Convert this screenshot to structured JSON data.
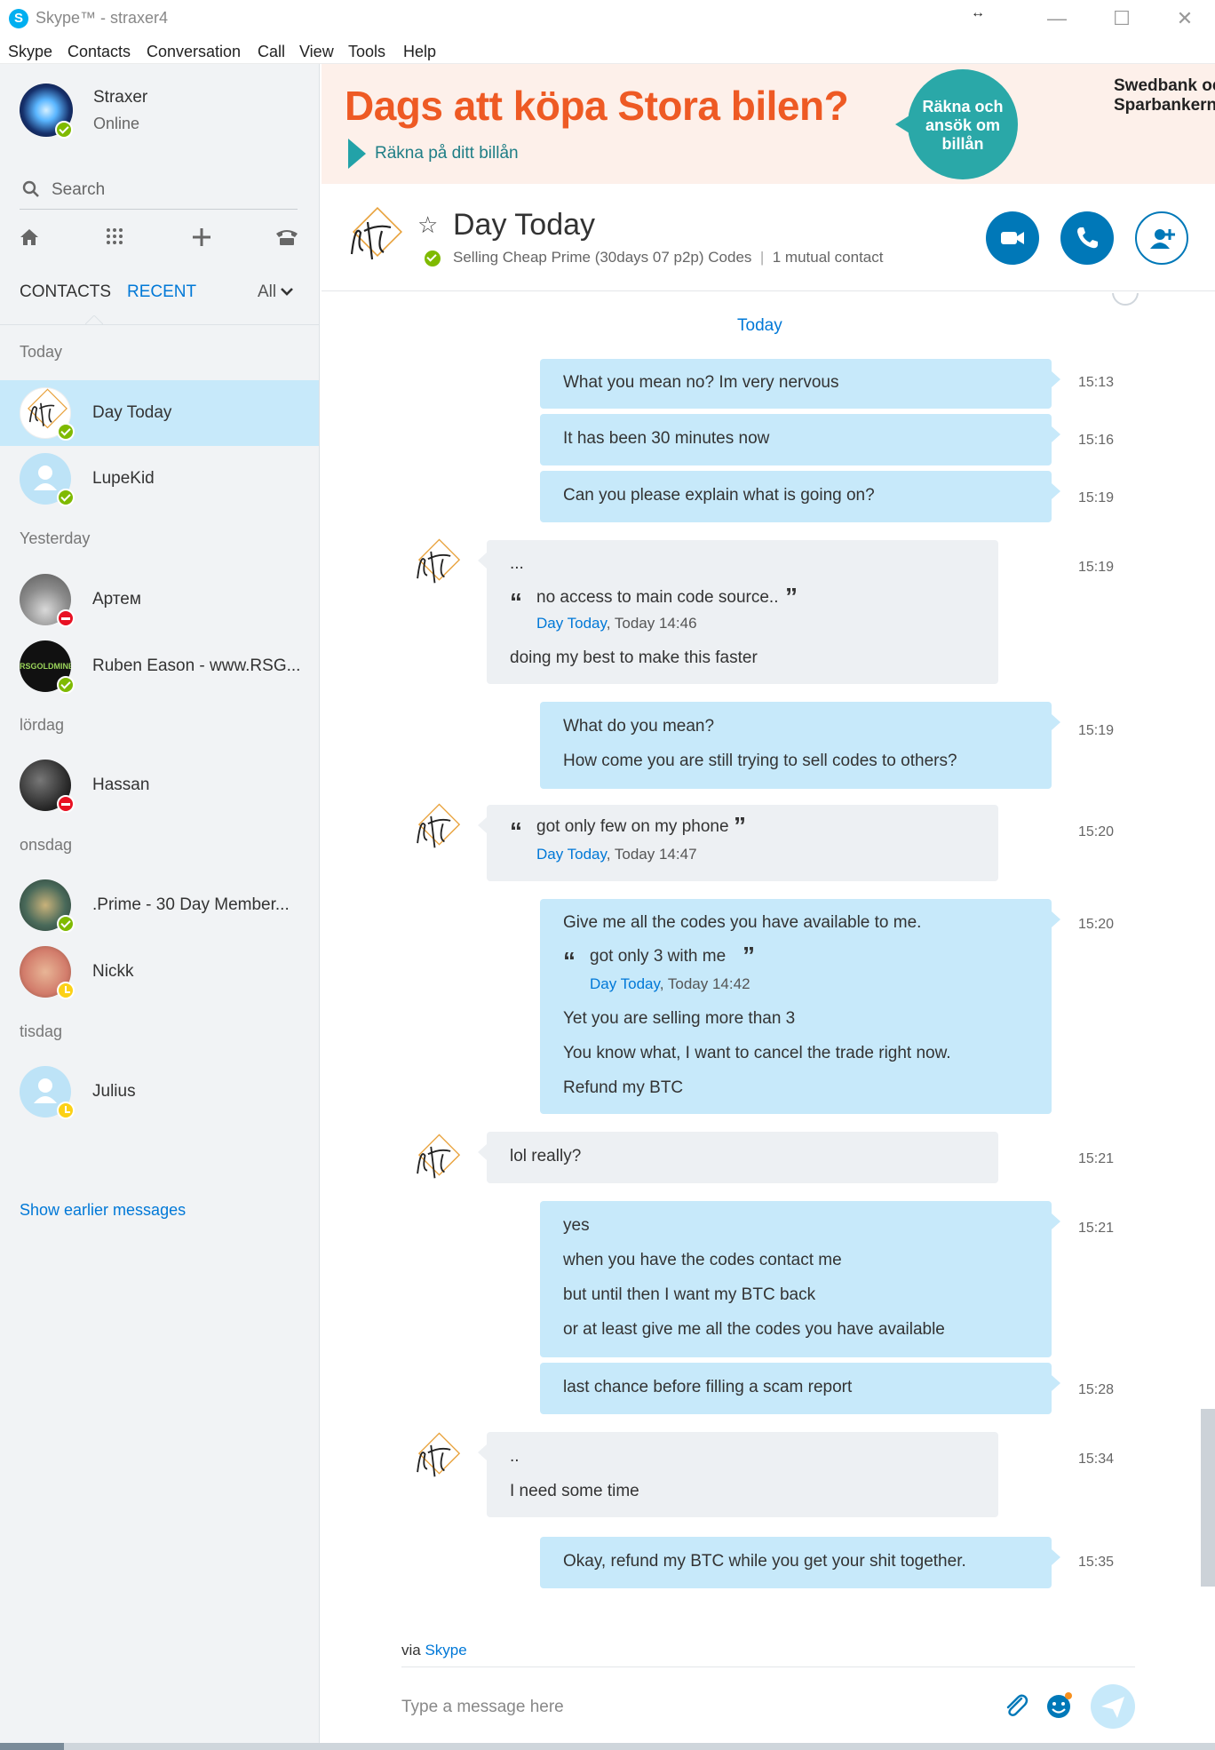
{
  "window": {
    "title": "Skype™ - straxer4",
    "controls": {
      "minimize": "—",
      "maximize": "☐",
      "close": "✕"
    }
  },
  "menu": [
    "Skype",
    "Contacts",
    "Conversation",
    "Call",
    "View",
    "Tools",
    "Help"
  ],
  "profile": {
    "name": "Straxer",
    "status": "Online"
  },
  "search": {
    "placeholder": "Search"
  },
  "tabs": {
    "contacts": "CONTACTS",
    "recent": "RECENT",
    "filter": "All"
  },
  "sections": {
    "today": "Today",
    "yesterday": "Yesterday",
    "saturday": "lördag",
    "wednesday": "onsdag",
    "tuesday": "tisdag"
  },
  "contacts": [
    {
      "name": "Day Today",
      "status": "online"
    },
    {
      "name": "LupeKid",
      "status": "online"
    },
    {
      "name": "Артем",
      "status": "busy"
    },
    {
      "name": "Ruben Eason - www.RSG...",
      "status": "online",
      "avatar_text": "RSGOLDMINE"
    },
    {
      "name": "Hassan",
      "status": "busy"
    },
    {
      "name": ".Prime - 30 Day Member...",
      "status": "online"
    },
    {
      "name": "Nickk",
      "status": "away"
    },
    {
      "name": "Julius",
      "status": "away"
    }
  ],
  "show_earlier": "Show earlier messages",
  "ad": {
    "headline": "Dags att köpa Stora bilen?",
    "subline": "Räkna på ditt billån",
    "cta": "Räkna och ansök om billån",
    "brand_line1": "Swedbank och",
    "brand_line2": "Sparbankerna"
  },
  "conversation": {
    "name": "Day Today",
    "mood": "Selling Cheap Prime (30days 07 p2p) Codes",
    "mutual": "1 mutual contact",
    "divider": "Today",
    "messages": {
      "m1": {
        "text": "What you mean no? Im very nervous",
        "time": "15:13"
      },
      "m2": {
        "text": "It has been 30 minutes now",
        "time": "15:16"
      },
      "m3": {
        "text": "Can you please explain what is going on?",
        "time": "15:19"
      },
      "m4": {
        "line1": "...",
        "quote": "no access to main code source..",
        "quote_author": "Day Today",
        "quote_time": ", Today 14:46",
        "line2": "doing my best to make this faster",
        "time": "15:19"
      },
      "m5": {
        "line1": "What do you mean?",
        "line2": "How come you are still trying to sell codes to others?",
        "time": "15:19"
      },
      "m6": {
        "quote": "got only few on my phone",
        "quote_author": "Day Today",
        "quote_time": ", Today 14:47",
        "time": "15:20"
      },
      "m7": {
        "line1": "Give me all the codes you have available to me.",
        "quote": "got only 3 with me",
        "quote_author": "Day Today",
        "quote_time": ", Today 14:42",
        "line2": "Yet you are selling more than 3",
        "line3": "You know what, I want to cancel the trade right now.",
        "line4": "Refund my BTC",
        "time": "15:20"
      },
      "m8": {
        "text": "lol really?",
        "time": "15:21"
      },
      "m9": {
        "line1": "yes",
        "line2": "when you have the codes contact me",
        "line3": "but until then I want my BTC back",
        "line4": "or at least give me all the codes you have available",
        "time": "15:21"
      },
      "m10": {
        "text": "last chance before filling a scam report",
        "time": "15:28"
      },
      "m11": {
        "line1": "..",
        "line2": "I need some time",
        "time": "15:34"
      },
      "m12": {
        "text": "Okay, refund my BTC while you get your shit together.",
        "time": "15:35"
      }
    }
  },
  "composer": {
    "via_prefix": "via ",
    "via_link": "Skype",
    "placeholder": "Type a message here"
  },
  "colors": {
    "accent": "#0078d7",
    "outgoing_bubble": "#c7e9fa",
    "incoming_bubble": "#edf0f3",
    "ad_orange": "#ee5a24",
    "ad_teal": "#2aa8a8"
  }
}
